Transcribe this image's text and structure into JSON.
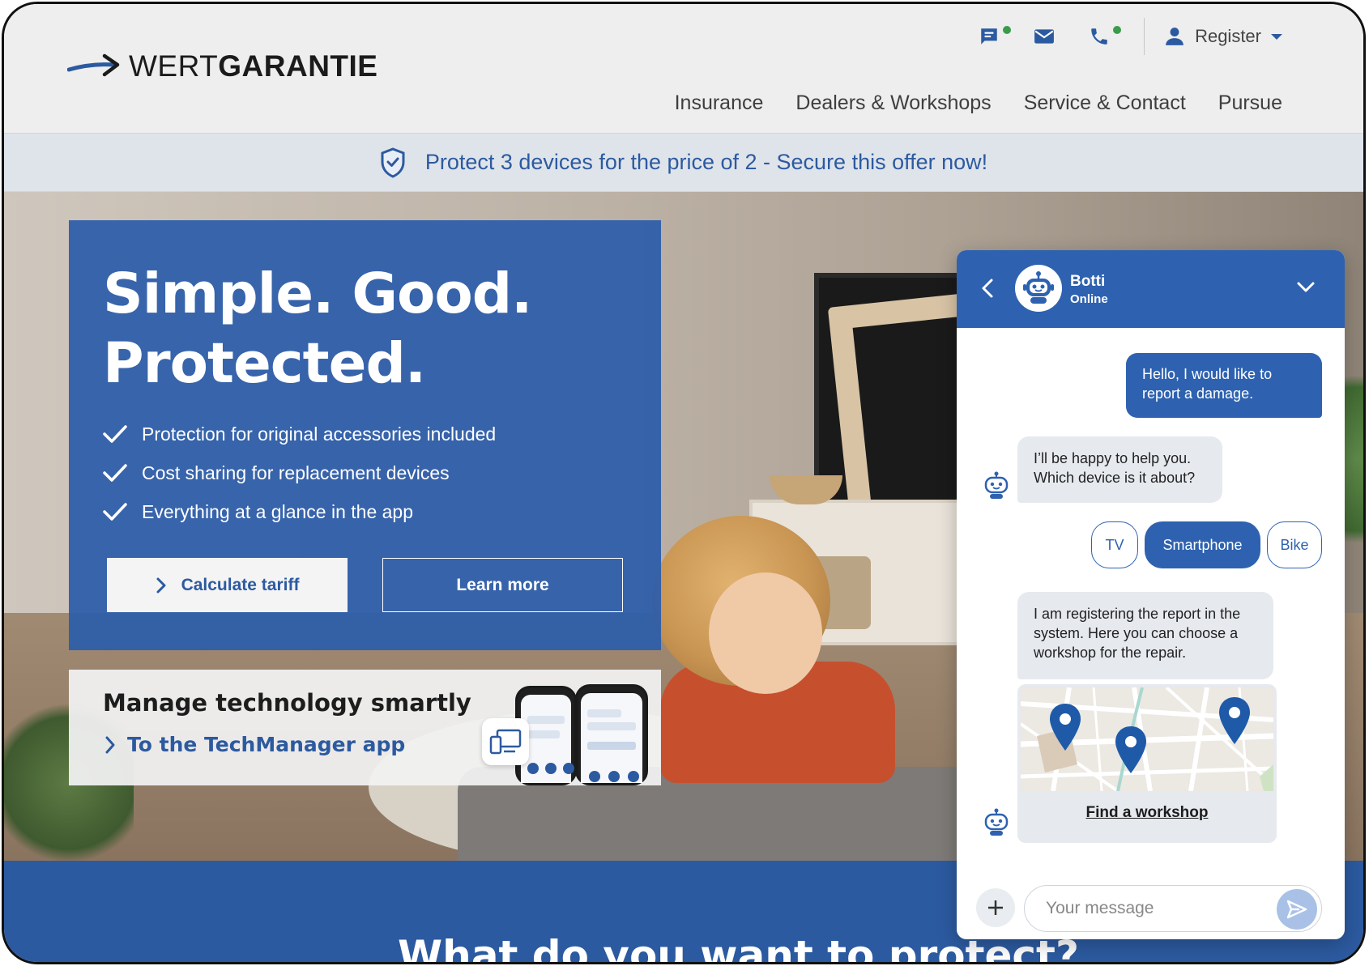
{
  "brand": {
    "logo_light": "WERT",
    "logo_bold": "GARANTIE",
    "primary_color": "#2c5aa0"
  },
  "header": {
    "utility_icons": [
      "chat-icon",
      "mail-icon",
      "phone-icon"
    ],
    "register_label": "Register",
    "nav": [
      "Insurance",
      "Dealers & Workshops",
      "Service & Contact",
      "Pursue"
    ]
  },
  "promo": {
    "text": "Protect 3 devices for the price of 2 - Secure this offer now!"
  },
  "hero": {
    "title_line1": "Simple. Good.",
    "title_line2": "Protected.",
    "bullets": [
      "Protection for original accessories included",
      "Cost sharing for replacement devices",
      "Everything at a glance in the app"
    ],
    "primary_cta": "Calculate tariff",
    "secondary_cta": "Learn more"
  },
  "app_teaser": {
    "title": "Manage technology smartly",
    "link": "To the TechManager app"
  },
  "section": {
    "title": "What do you want to protect?"
  },
  "chat": {
    "bot_name": "Botti",
    "status": "Online",
    "messages": {
      "user_1": "Hello, I would like to report a damage.",
      "bot_1": "I’ll be happy to help you. Which device is it about?",
      "bot_2": "I am registering the report in the system. Here you can choose a workshop for the repair."
    },
    "choices": [
      "TV",
      "Smartphone",
      "Bike"
    ],
    "selected_choice": "Smartphone",
    "map_link": "Find a workshop",
    "input_placeholder": "Your message"
  }
}
